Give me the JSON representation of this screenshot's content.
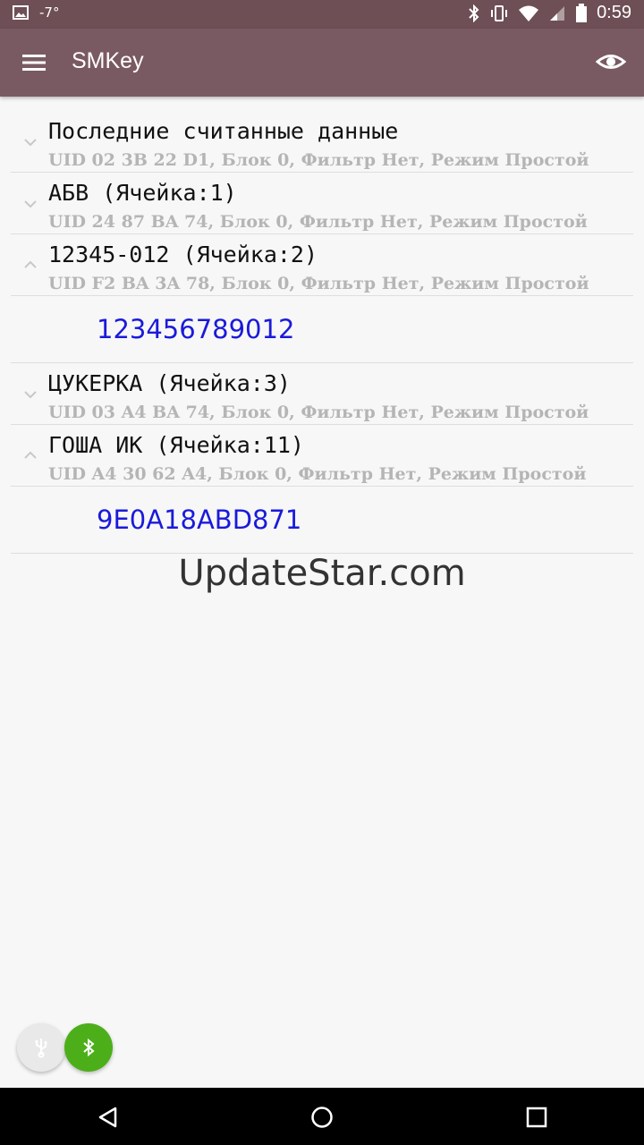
{
  "status_bar": {
    "temperature": "-7°",
    "time": "0:59"
  },
  "app_bar": {
    "title": "SMKey"
  },
  "entries": [
    {
      "title": "Последние считанные данные",
      "subtitle": "UID 02 3B 22 D1, Блок 0, Фильтр Нет, Режим Простой",
      "expanded": false
    },
    {
      "title": "АБВ (Ячейка:1)",
      "subtitle": "UID 24 87 BA 74, Блок 0, Фильтр Нет, Режим Простой",
      "expanded": false
    },
    {
      "title": "12345-012 (Ячейка:2)",
      "subtitle": "UID F2 BA 3A 78, Блок 0, Фильтр Нет, Режим Простой",
      "expanded": true,
      "code": "123456789012"
    },
    {
      "title": "ЦУКЕРКА (Ячейка:3)",
      "subtitle": "UID 03 A4 BA 74, Блок 0, Фильтр Нет, Режим Простой",
      "expanded": false
    },
    {
      "title": "ГОША ИК (Ячейка:11)",
      "subtitle": "UID A4 30 62 A4, Блок 0, Фильтр Нет, Режим Простой",
      "expanded": true,
      "code": "9E0A18ABD871"
    }
  ],
  "watermark": "UpdateStar.com",
  "icons": {
    "menu": "menu-icon",
    "eye": "eye-icon",
    "usb": "usb-icon",
    "bluetooth": "bluetooth-icon",
    "back": "back-icon",
    "home": "home-icon",
    "recents": "recents-icon"
  },
  "colors": {
    "status_bar": "#6e4f56",
    "app_bar": "#7a5a62",
    "code_text": "#1a1adb",
    "bluetooth_fab": "#4caf1a"
  }
}
